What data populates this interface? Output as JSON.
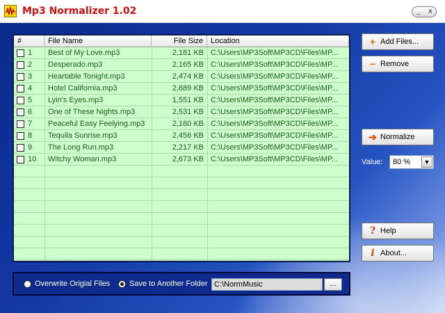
{
  "window": {
    "title": "Mp3 Normalizer 1.02",
    "minimize_label": "_",
    "close_label": "x"
  },
  "list": {
    "columns": [
      "#",
      "File Name",
      "File Size",
      "Location"
    ],
    "rows": [
      {
        "num": "1",
        "name": "Best of My Love.mp3",
        "size": "2,181 KB",
        "location": "C:\\Users\\MP3Soft\\MP3CD\\Files\\MP..."
      },
      {
        "num": "2",
        "name": "Desperado.mp3",
        "size": "2,165 KB",
        "location": "C:\\Users\\MP3Soft\\MP3CD\\Files\\MP..."
      },
      {
        "num": "3",
        "name": "Heartable Tonight.mp3",
        "size": "2,474 KB",
        "location": "C:\\Users\\MP3Soft\\MP3CD\\Files\\MP..."
      },
      {
        "num": "4",
        "name": "Hotel California.mp3",
        "size": "2,689 KB",
        "location": "C:\\Users\\MP3Soft\\MP3CD\\Files\\MP..."
      },
      {
        "num": "5",
        "name": "Lyin's Eyes.mp3",
        "size": "1,551 KB",
        "location": "C:\\Users\\MP3Soft\\MP3CD\\Files\\MP..."
      },
      {
        "num": "6",
        "name": "One of These Nights.mp3",
        "size": "2,531 KB",
        "location": "C:\\Users\\MP3Soft\\MP3CD\\Files\\MP..."
      },
      {
        "num": "7",
        "name": "Peaceful Easy Feelying.mp3",
        "size": "2,180 KB",
        "location": "C:\\Users\\MP3Soft\\MP3CD\\Files\\MP..."
      },
      {
        "num": "8",
        "name": "Tequila Sunrise.mp3",
        "size": "2,456 KB",
        "location": "C:\\Users\\MP3Soft\\MP3CD\\Files\\MP..."
      },
      {
        "num": "9",
        "name": "The Long Run.mp3",
        "size": "2,217 KB",
        "location": "C:\\Users\\MP3Soft\\MP3CD\\Files\\MP..."
      },
      {
        "num": "10",
        "name": "Witchy Woman.mp3",
        "size": "2,673 KB",
        "location": "C:\\Users\\MP3Soft\\MP3CD\\Files\\MP..."
      }
    ],
    "empty_rows": 8
  },
  "buttons": {
    "add_files": "Add Files...",
    "remove": "Remove",
    "normalize": "Normalize",
    "help": "Help",
    "about": "About..."
  },
  "icons": {
    "add_files": "plus-icon",
    "remove": "minus-icon",
    "normalize": "arrow-right-icon",
    "help": "question-icon",
    "about": "info-icon"
  },
  "value": {
    "label": "Value:",
    "selected": "80 %"
  },
  "options": {
    "overwrite_label": "Overwrite Origial Files",
    "save_label": "Save to Another Folder",
    "selected": "save",
    "folder_path": "C:\\NormMusic",
    "browse_label": "..."
  },
  "colors": {
    "title": "#cc1010",
    "list_background": "#ccffcc",
    "list_text": "#1a5c1a",
    "panel_background": "#0d2a8c"
  }
}
